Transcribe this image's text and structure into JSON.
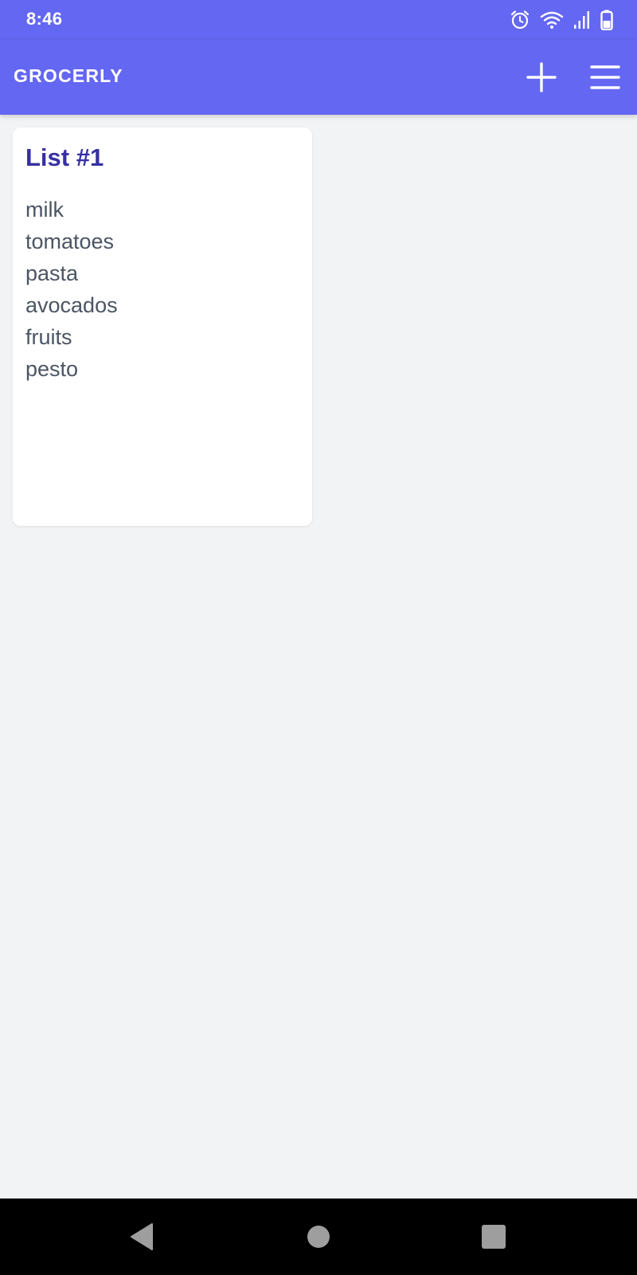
{
  "status_bar": {
    "time": "8:46",
    "icons": [
      "alarm-icon",
      "wifi-icon",
      "signal-icon",
      "battery-icon"
    ]
  },
  "app_bar": {
    "title": "GROCERLY",
    "actions": [
      "add-icon",
      "menu-icon"
    ]
  },
  "lists": [
    {
      "title": "List #1",
      "items": [
        "milk",
        "tomatoes",
        "pasta",
        "avocados",
        "fruits",
        "pesto"
      ]
    }
  ],
  "nav_bar": {
    "buttons": [
      "back-icon",
      "home-icon",
      "recents-icon"
    ]
  },
  "colors": {
    "primary": "#6467f2",
    "card_title": "#3730a3",
    "item_text": "#4b5563",
    "background": "#f2f3f5"
  }
}
